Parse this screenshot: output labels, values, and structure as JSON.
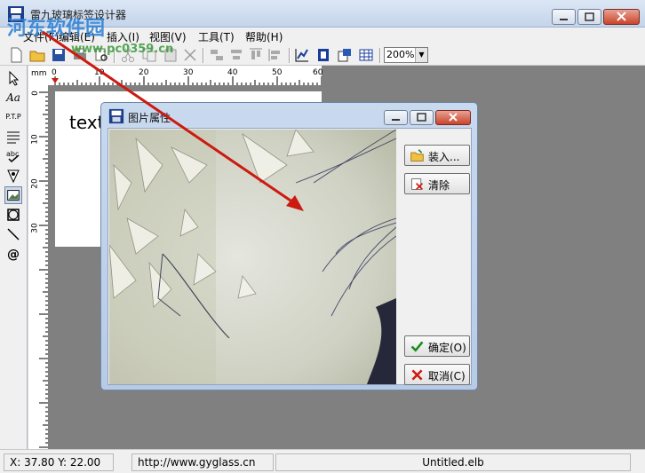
{
  "app": {
    "title": "雷九玻璃标签设计器"
  },
  "menu": [
    "文件(F)",
    "编辑(E)",
    "插入(I)",
    "视图(V)",
    "工具(T)",
    "帮助(H)"
  ],
  "toolbar": {
    "zoom": "200%"
  },
  "ruler": {
    "unit": "mm",
    "h_ticks": [
      "0",
      "10",
      "20",
      "30",
      "40",
      "50",
      "60"
    ],
    "v_ticks": [
      "0",
      "10",
      "20",
      "30"
    ]
  },
  "tools_left": [
    "Aa",
    "P.T.P"
  ],
  "page": {
    "text": "text"
  },
  "dialog": {
    "title": "图片属性",
    "load_label": "装入...",
    "clear_label": "清除",
    "ok_label": "确定(O)",
    "cancel_label": "取消(C)"
  },
  "status": {
    "coords": "X: 37.80  Y: 22.00",
    "url": "http://www.gyglass.cn",
    "file": "Untitled.elb"
  },
  "watermark": {
    "name": "河东软件园",
    "url": "www.pc0359.cn"
  },
  "colors": {
    "accent": "#cc1a10",
    "titlebar": "#c4d4ea"
  }
}
